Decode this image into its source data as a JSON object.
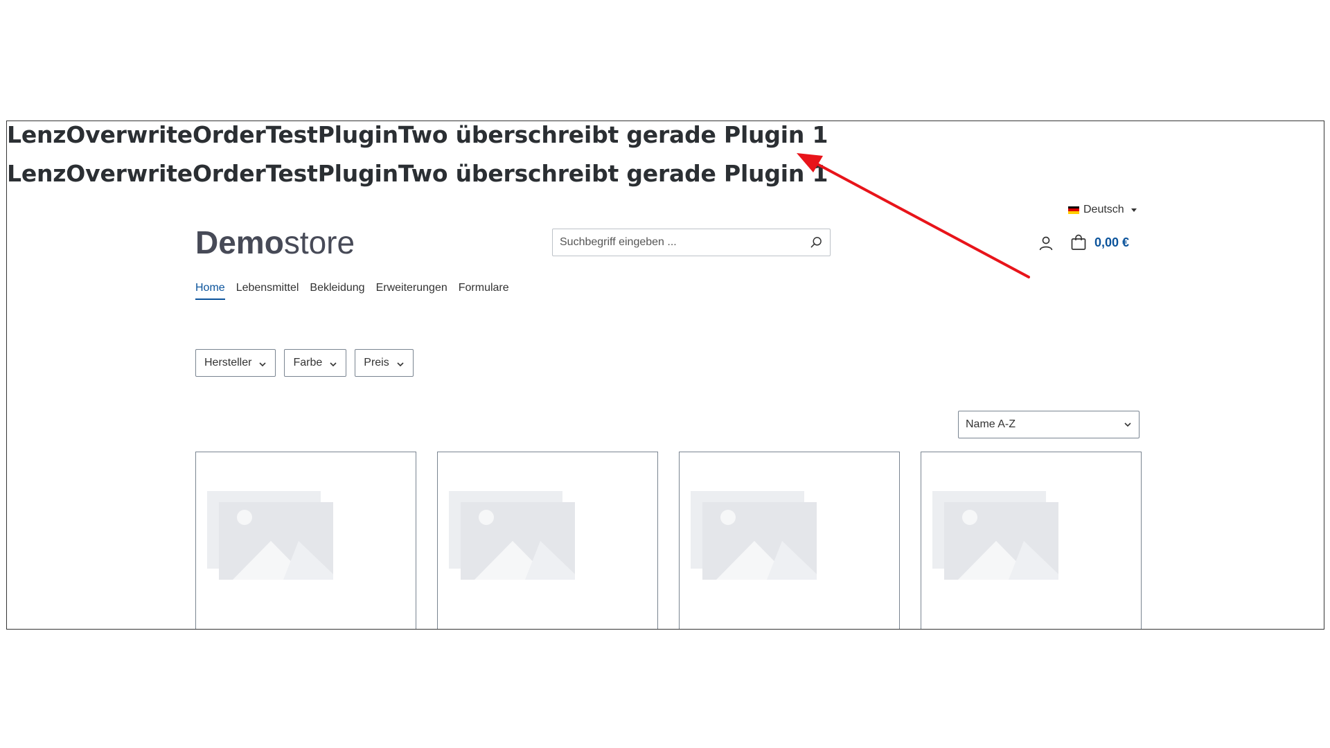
{
  "plugin_messages": [
    "LenzOverwriteOrderTestPluginTwo überschreibt gerade Plugin 1",
    "LenzOverwriteOrderTestPluginTwo überschreibt gerade Plugin 1"
  ],
  "header": {
    "language": "Deutsch",
    "logo": {
      "bold": "Demo",
      "light": "store"
    },
    "search": {
      "placeholder": "Suchbegriff eingeben ..."
    },
    "cart_total": "0,00 €"
  },
  "nav": {
    "items": [
      "Home",
      "Lebensmittel",
      "Bekleidung",
      "Erweiterungen",
      "Formulare"
    ],
    "active": "Home"
  },
  "filters": [
    "Hersteller",
    "Farbe",
    "Preis"
  ],
  "sort": {
    "selected": "Name A-Z"
  },
  "colors": {
    "accent": "#0b539b",
    "annotation_arrow": "#e8141a",
    "placeholder": "#e7e8ec"
  },
  "icons": [
    "flag-de-icon",
    "search-icon",
    "account-icon",
    "cart-icon",
    "chevron-down-icon",
    "image-placeholder-icon"
  ]
}
